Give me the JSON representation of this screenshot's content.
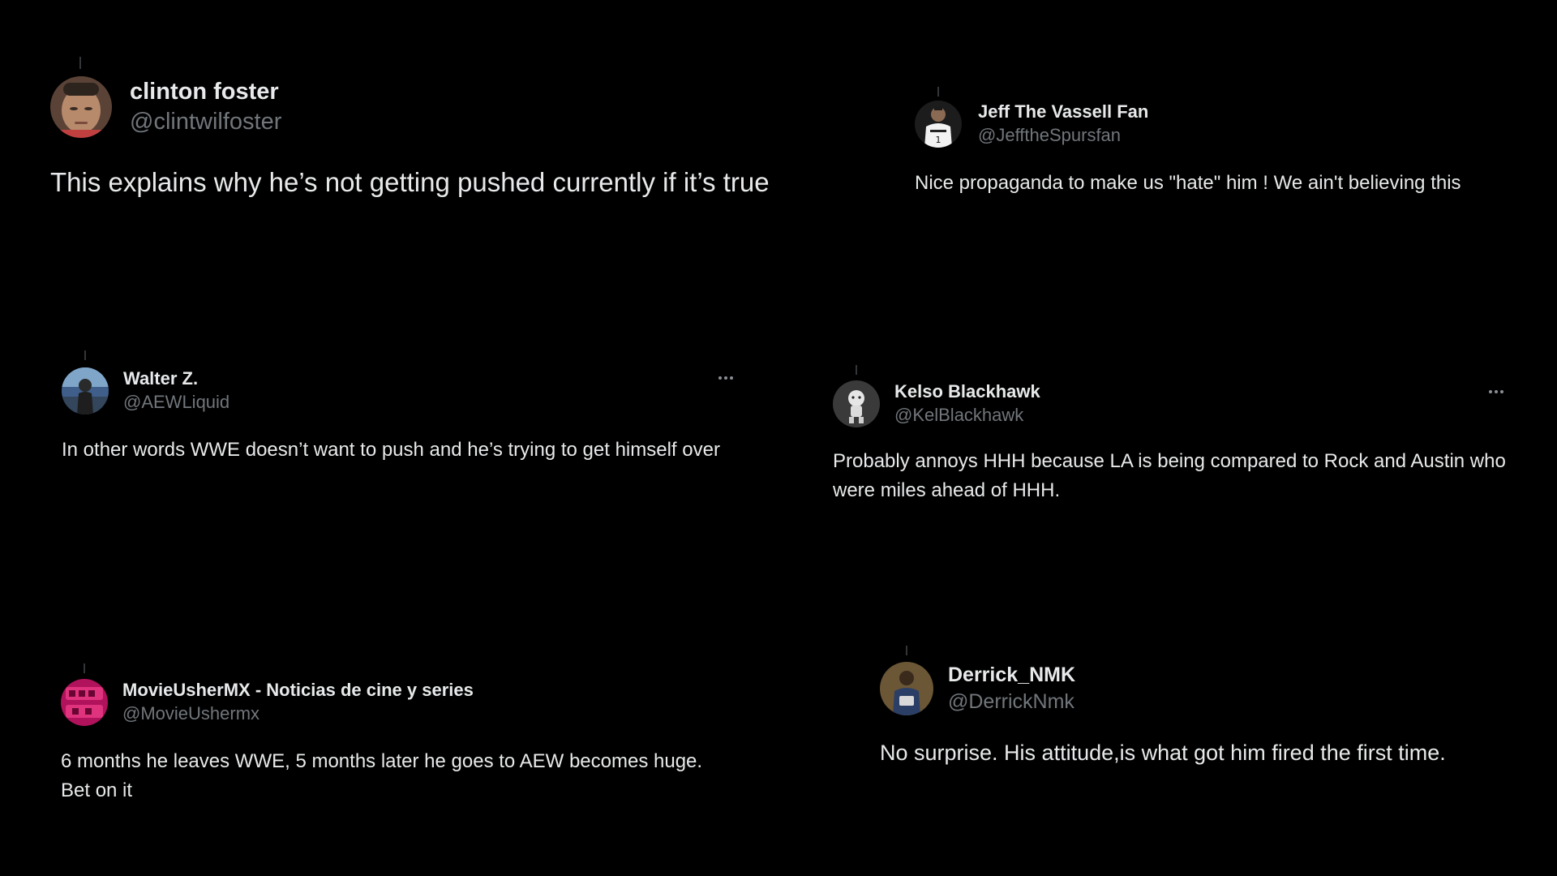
{
  "tweets": [
    {
      "name": "clinton foster",
      "handle": "@clintwilfoster",
      "text": "This explains why he’s not getting pushed currently if it’s true",
      "avatar_icon": "user-photo-avatar"
    },
    {
      "name": "Jeff The Vassell Fan",
      "handle": "@JefftheSpursfan",
      "text": "Nice propaganda to make us \"hate\" him ! We ain't believing this",
      "avatar_icon": "basketball-player-avatar"
    },
    {
      "name": "Walter Z.",
      "handle": "@AEWLiquid",
      "text": "In other words WWE doesn’t want to push and he’s trying to get himself over",
      "avatar_icon": "user-photo-avatar"
    },
    {
      "name": "Kelso Blackhawk",
      "handle": "@KelBlackhawk",
      "text": "Probably annoys HHH because LA is being compared to Rock and Austin who were miles ahead of HHH.",
      "avatar_icon": "figurine-avatar"
    },
    {
      "name": "MovieUsherMX - Noticias de cine y series",
      "handle": "@MovieUshermx",
      "text": "6 months he leaves WWE, 5 months later he goes to AEW becomes huge. Bet on it",
      "avatar_icon": "pink-logo-avatar"
    },
    {
      "name": "Derrick_NMK",
      "handle": "@DerrickNmk",
      "text": "No surprise. His attitude,is what got him fired the first time.",
      "avatar_icon": "user-photo-avatar"
    }
  ],
  "colors": {
    "background": "#000000",
    "primary_text": "#e7e9ea",
    "secondary_text": "#71767b"
  }
}
